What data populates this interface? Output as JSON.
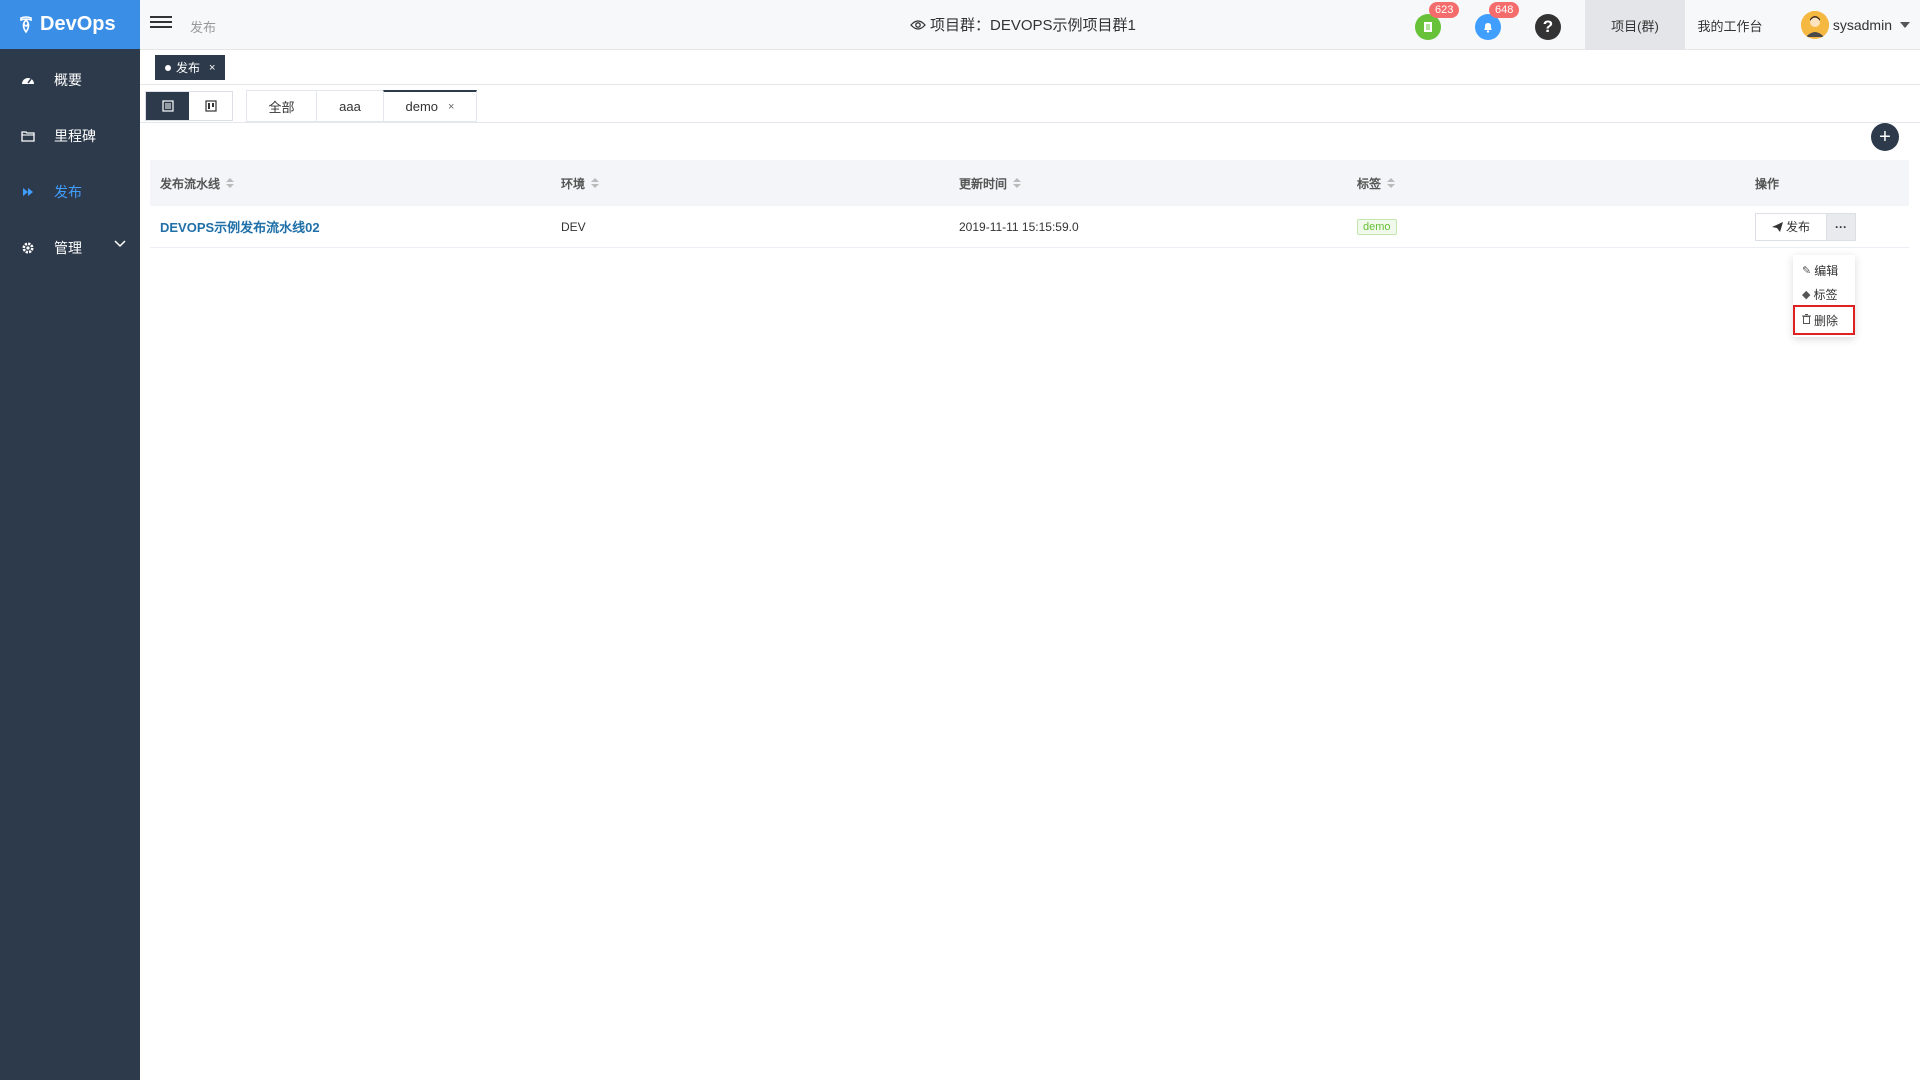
{
  "app": {
    "name": "DevOps"
  },
  "sidebar": {
    "items": [
      {
        "label": "概要",
        "icon": "dashboard-icon"
      },
      {
        "label": "里程碑",
        "icon": "folder-icon"
      },
      {
        "label": "发布",
        "icon": "forward-icon",
        "active": true
      },
      {
        "label": "管理",
        "icon": "gear-icon",
        "expandable": true
      }
    ]
  },
  "header": {
    "breadcrumb": "发布",
    "project_title": "项目群：DEVOPS示例项目群1",
    "task_badge": "623",
    "notify_badge": "648",
    "help_symbol": "?",
    "tabs": [
      "项目(群)",
      "我的工作台"
    ],
    "username": "sysadmin"
  },
  "page_tags": [
    {
      "label": "发布",
      "close": "×"
    }
  ],
  "filter_tabs": [
    {
      "label": "全部"
    },
    {
      "label": "aaa"
    },
    {
      "label": "demo",
      "close": "×",
      "active": true
    }
  ],
  "add_button": "+",
  "table": {
    "columns": [
      "发布流水线",
      "环境",
      "更新时间",
      "标签",
      "操作"
    ],
    "rows": [
      {
        "pipeline": "DEVOPS示例发布流水线02",
        "env": "DEV",
        "updated": "2019-11-11 15:15:59.0",
        "tag": "demo",
        "action_label": "发布",
        "more_label": "···"
      }
    ]
  },
  "dropdown": {
    "items": [
      {
        "label": "编辑",
        "icon": "edit-icon"
      },
      {
        "label": "标签",
        "icon": "tag-icon"
      },
      {
        "label": "删除",
        "icon": "trash-icon",
        "highlighted": true
      }
    ]
  },
  "colors": {
    "sidebar_bg": "#2d3a4b",
    "logo_bg": "#3a8ee6",
    "active_nav": "#409eff",
    "badge": "#f56c6c",
    "link": "#1f6fa8",
    "tag_green": "#67c23a",
    "highlight_red": "#e02020"
  }
}
